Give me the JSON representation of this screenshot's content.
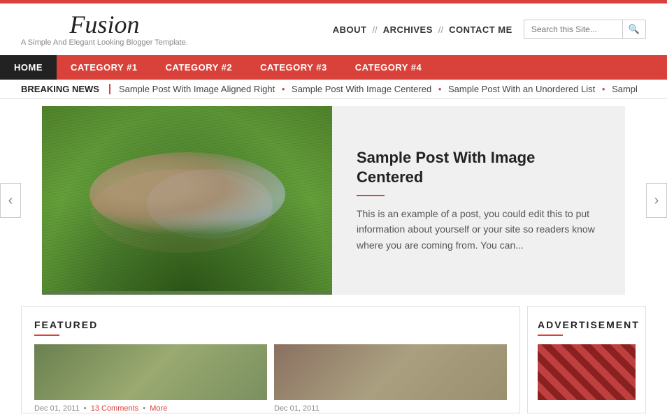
{
  "topBar": {},
  "header": {
    "logoTitle": "Fusion",
    "logoTagline": "A Simple And Elegant Looking Blogger Template.",
    "nav": {
      "items": [
        {
          "label": "ABOUT",
          "id": "about"
        },
        {
          "sep": "//"
        },
        {
          "label": "ARCHIVES",
          "id": "archives"
        },
        {
          "sep": "//"
        },
        {
          "label": "CONTACT ME",
          "id": "contact"
        }
      ]
    },
    "search": {
      "placeholder": "Search this Site...",
      "icon": "🔍"
    }
  },
  "navBar": {
    "items": [
      {
        "label": "HOME",
        "active": true
      },
      {
        "label": "CATEGORY #1",
        "active": false
      },
      {
        "label": "CATEGORY #2",
        "active": false
      },
      {
        "label": "CATEGORY #3",
        "active": false
      },
      {
        "label": "CATEGORY #4",
        "active": false
      }
    ]
  },
  "breakingNews": {
    "label": "BREAKING NEWS",
    "items": [
      "Sample Post With Image Aligned Right",
      "Sample Post With Image Centered",
      "Sample Post With an Unordered List",
      "Sampl"
    ]
  },
  "slider": {
    "title": "Sample Post With Image Centered",
    "excerpt": "This is an example of a post, you could edit this to put information about yourself or your site so readers know where you are coming from. You can...",
    "arrowLeft": "‹",
    "arrowRight": "›"
  },
  "featured": {
    "heading": "FEATURED",
    "posts": [
      {
        "date": "Dec 01, 2011",
        "comments": "13 Comments",
        "more": "More"
      },
      {
        "date": "Dec 01, 2011",
        "comments": "",
        "more": ""
      }
    ]
  },
  "advertisement": {
    "heading": "ADVERTISEMENT"
  }
}
